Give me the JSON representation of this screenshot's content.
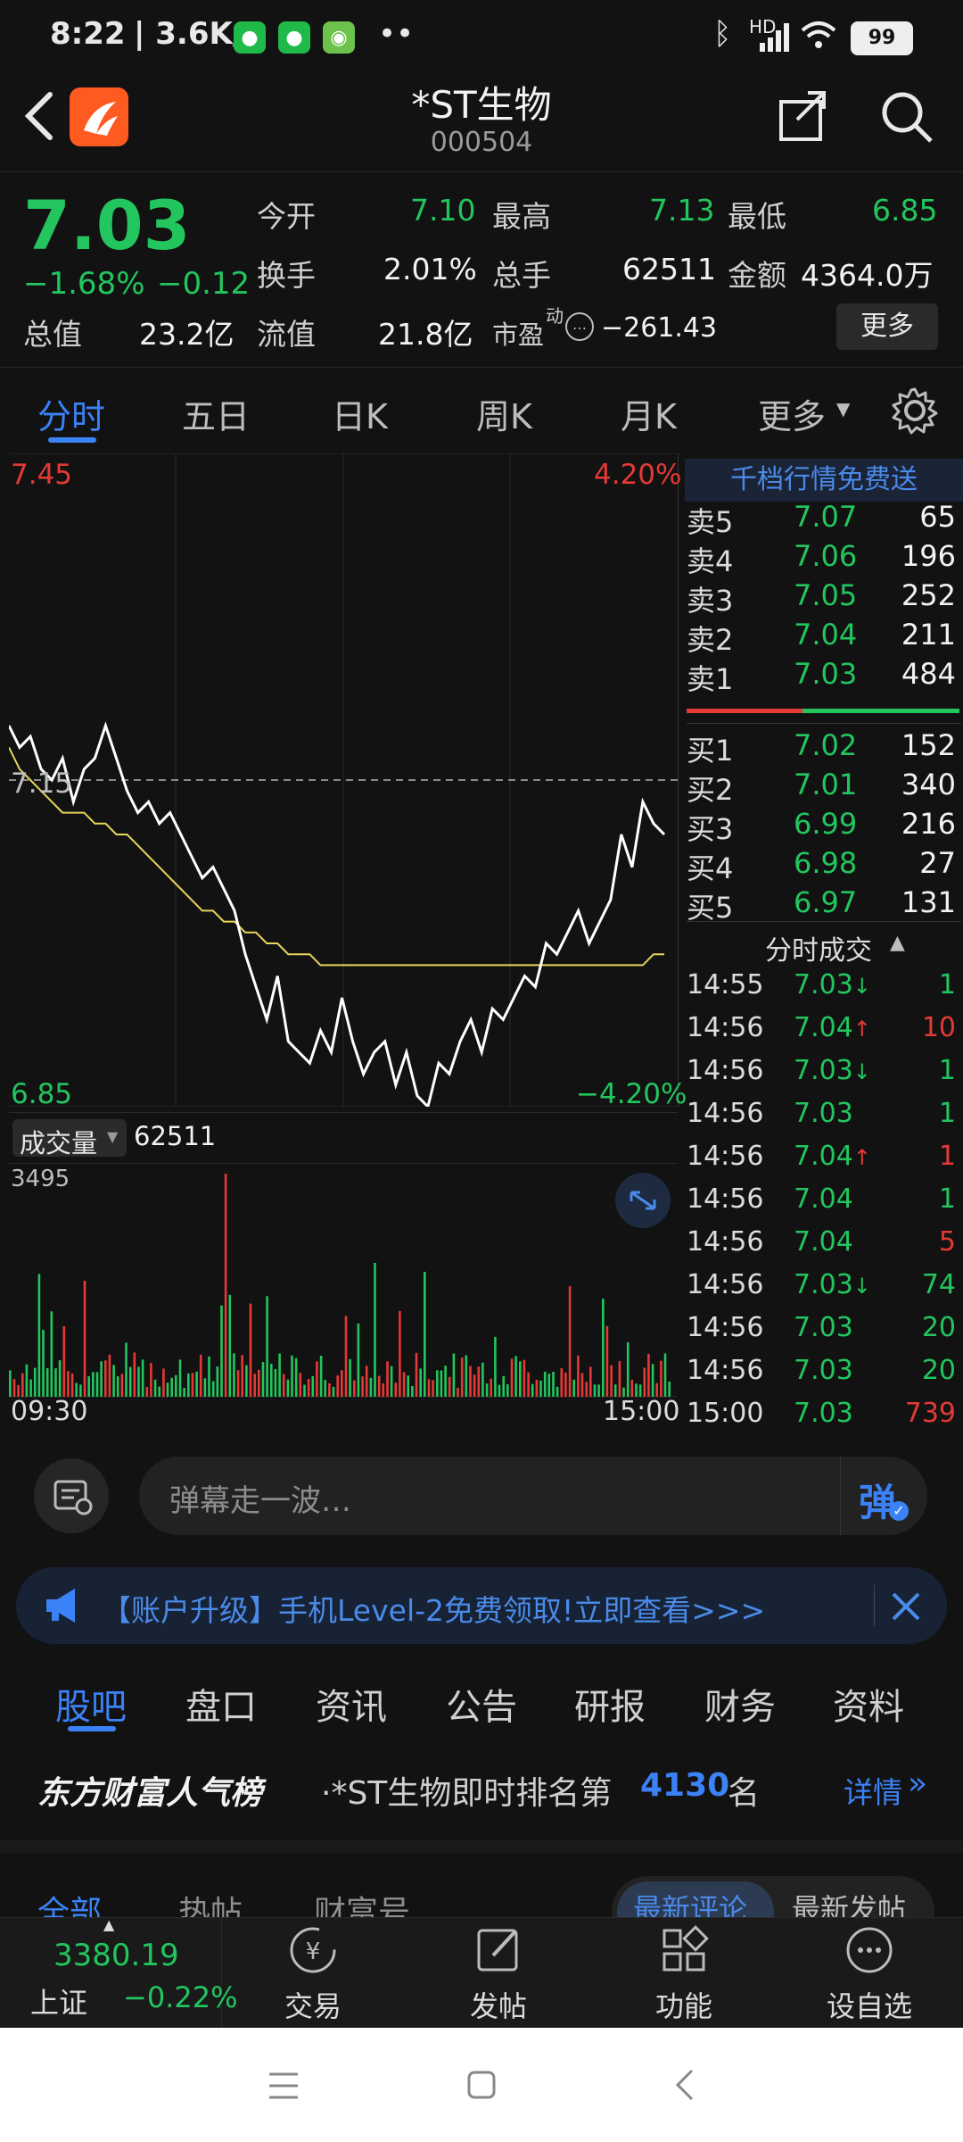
{
  "status_bar": {
    "time": "8:22",
    "speed": "| 3.6K/s",
    "battery": "99",
    "hd_label": "HD"
  },
  "header": {
    "title": "*ST生物",
    "code": "000504"
  },
  "quote": {
    "price": "7.03",
    "change_pct": "−1.68%",
    "change_abs": "−0.12",
    "open_label": "今开",
    "open": "7.10",
    "high_label": "最高",
    "high": "7.13",
    "low_label": "最低",
    "low": "6.85",
    "turnover_label": "换手",
    "turnover": "2.01%",
    "total_hands_label": "总手",
    "total_hands": "62511",
    "amount_label": "金额",
    "amount": "4364.0万",
    "market_cap_label": "总值",
    "market_cap": "23.2亿",
    "float_cap_label": "流值",
    "float_cap": "21.8亿",
    "pe_label": "市盈",
    "pe_sup": "动",
    "pe": "−261.43",
    "more_button": "更多"
  },
  "chart_tabs": [
    "分时",
    "五日",
    "日K",
    "周K",
    "月K",
    "更多"
  ],
  "chart": {
    "price_top": "7.45",
    "price_mid": "7.15",
    "price_bottom": "6.85",
    "pct_top": "4.20%",
    "pct_bottom": "−4.20%",
    "volume_label": "成交量",
    "volume_total": "62511",
    "volume_max": "3495",
    "time_start": "09:30",
    "time_end": "15:00"
  },
  "chart_data": {
    "type": "line",
    "x_range": [
      "09:30",
      "15:00"
    ],
    "ylim": [
      6.85,
      7.45
    ],
    "reference": 7.15,
    "series": [
      {
        "values": [
          7.2,
          7.18,
          7.19,
          7.16,
          7.15,
          7.17,
          7.13,
          7.16,
          7.17,
          7.2,
          7.17,
          7.14,
          7.12,
          7.13,
          7.11,
          7.12,
          7.1,
          7.08,
          7.06,
          7.07,
          7.05,
          7.03,
          6.99,
          6.96,
          6.93,
          6.97,
          6.91,
          6.9,
          6.89,
          6.92,
          6.9,
          6.95,
          6.91,
          6.88,
          6.9,
          6.91,
          6.87,
          6.9,
          6.86,
          6.85,
          6.89,
          6.88,
          6.91,
          6.93,
          6.9,
          6.94,
          6.93,
          6.95,
          6.97,
          6.96,
          7.0,
          6.99,
          7.01,
          7.03,
          7.0,
          7.02,
          7.04,
          7.1,
          7.07,
          7.13,
          7.11,
          7.1
        ]
      },
      {
        "values": [
          7.18,
          7.16,
          7.15,
          7.14,
          7.13,
          7.12,
          7.12,
          7.12,
          7.11,
          7.11,
          7.1,
          7.1,
          7.09,
          7.08,
          7.07,
          7.06,
          7.05,
          7.04,
          7.03,
          7.03,
          7.02,
          7.02,
          7.01,
          7.01,
          7.0,
          7.0,
          6.99,
          6.99,
          6.99,
          6.98,
          6.98,
          6.98,
          6.98,
          6.98,
          6.98,
          6.98,
          6.98,
          6.98,
          6.98,
          6.98,
          6.98,
          6.98,
          6.98,
          6.98,
          6.98,
          6.98,
          6.98,
          6.98,
          6.98,
          6.98,
          6.98,
          6.98,
          6.98,
          6.98,
          6.98,
          6.98,
          6.98,
          6.98,
          6.98,
          6.98,
          6.99,
          6.99
        ]
      }
    ]
  },
  "orderbook": {
    "promo": "千档行情免费送",
    "asks": [
      {
        "label": "卖5",
        "price": "7.07",
        "qty": "65"
      },
      {
        "label": "卖4",
        "price": "7.06",
        "qty": "196"
      },
      {
        "label": "卖3",
        "price": "7.05",
        "qty": "252"
      },
      {
        "label": "卖2",
        "price": "7.04",
        "qty": "211"
      },
      {
        "label": "卖1",
        "price": "7.03",
        "qty": "484"
      }
    ],
    "bids": [
      {
        "label": "买1",
        "price": "7.02",
        "qty": "152"
      },
      {
        "label": "买2",
        "price": "7.01",
        "qty": "340"
      },
      {
        "label": "买3",
        "price": "6.99",
        "qty": "216"
      },
      {
        "label": "买4",
        "price": "6.98",
        "qty": "27"
      },
      {
        "label": "买5",
        "price": "6.97",
        "qty": "131"
      }
    ],
    "trades_title": "分时成交",
    "trades": [
      {
        "time": "14:55",
        "price": "7.03",
        "dir": "↓",
        "qty": "1",
        "qty_color": "g"
      },
      {
        "time": "14:56",
        "price": "7.04",
        "dir": "↑",
        "qty": "10",
        "qty_color": "r"
      },
      {
        "time": "14:56",
        "price": "7.03",
        "dir": "↓",
        "qty": "1",
        "qty_color": "g"
      },
      {
        "time": "14:56",
        "price": "7.03",
        "dir": "",
        "qty": "1",
        "qty_color": "g"
      },
      {
        "time": "14:56",
        "price": "7.04",
        "dir": "↑",
        "qty": "1",
        "qty_color": "r"
      },
      {
        "time": "14:56",
        "price": "7.04",
        "dir": "",
        "qty": "1",
        "qty_color": "g"
      },
      {
        "time": "14:56",
        "price": "7.04",
        "dir": "",
        "qty": "5",
        "qty_color": "r"
      },
      {
        "time": "14:56",
        "price": "7.03",
        "dir": "↓",
        "qty": "74",
        "qty_color": "g"
      },
      {
        "time": "14:56",
        "price": "7.03",
        "dir": "",
        "qty": "20",
        "qty_color": "g"
      },
      {
        "time": "14:56",
        "price": "7.03",
        "dir": "",
        "qty": "20",
        "qty_color": "g"
      },
      {
        "time": "15:00",
        "price": "7.03",
        "dir": "",
        "qty": "739",
        "qty_color": "r"
      }
    ]
  },
  "danmaku": {
    "placeholder": "弹幕走一波…",
    "button": "弹"
  },
  "banner": {
    "text": "【账户升级】手机Level-2免费领取!立即查看>>>"
  },
  "bottom_tabs": [
    "股吧",
    "盘口",
    "资讯",
    "公告",
    "研报",
    "财务",
    "资料"
  ],
  "ranking": {
    "brand": "东方财富人气榜",
    "text": "·*ST生物即时排名第",
    "rank": "4130",
    "unit": "名",
    "detail": "详情"
  },
  "sub_tabs": {
    "left": [
      "全部",
      "热帖",
      "财富号"
    ],
    "right": [
      "最新评论",
      "最新发帖"
    ]
  },
  "bottom_nav": {
    "index_value": "3380.19",
    "index_name": "上证",
    "index_change": "−0.22%",
    "items": [
      "交易",
      "发帖",
      "功能",
      "设自选"
    ]
  },
  "colors": {
    "up": "#e53935",
    "down": "#22c55e",
    "accent": "#3b82f6",
    "background": "#121212"
  }
}
